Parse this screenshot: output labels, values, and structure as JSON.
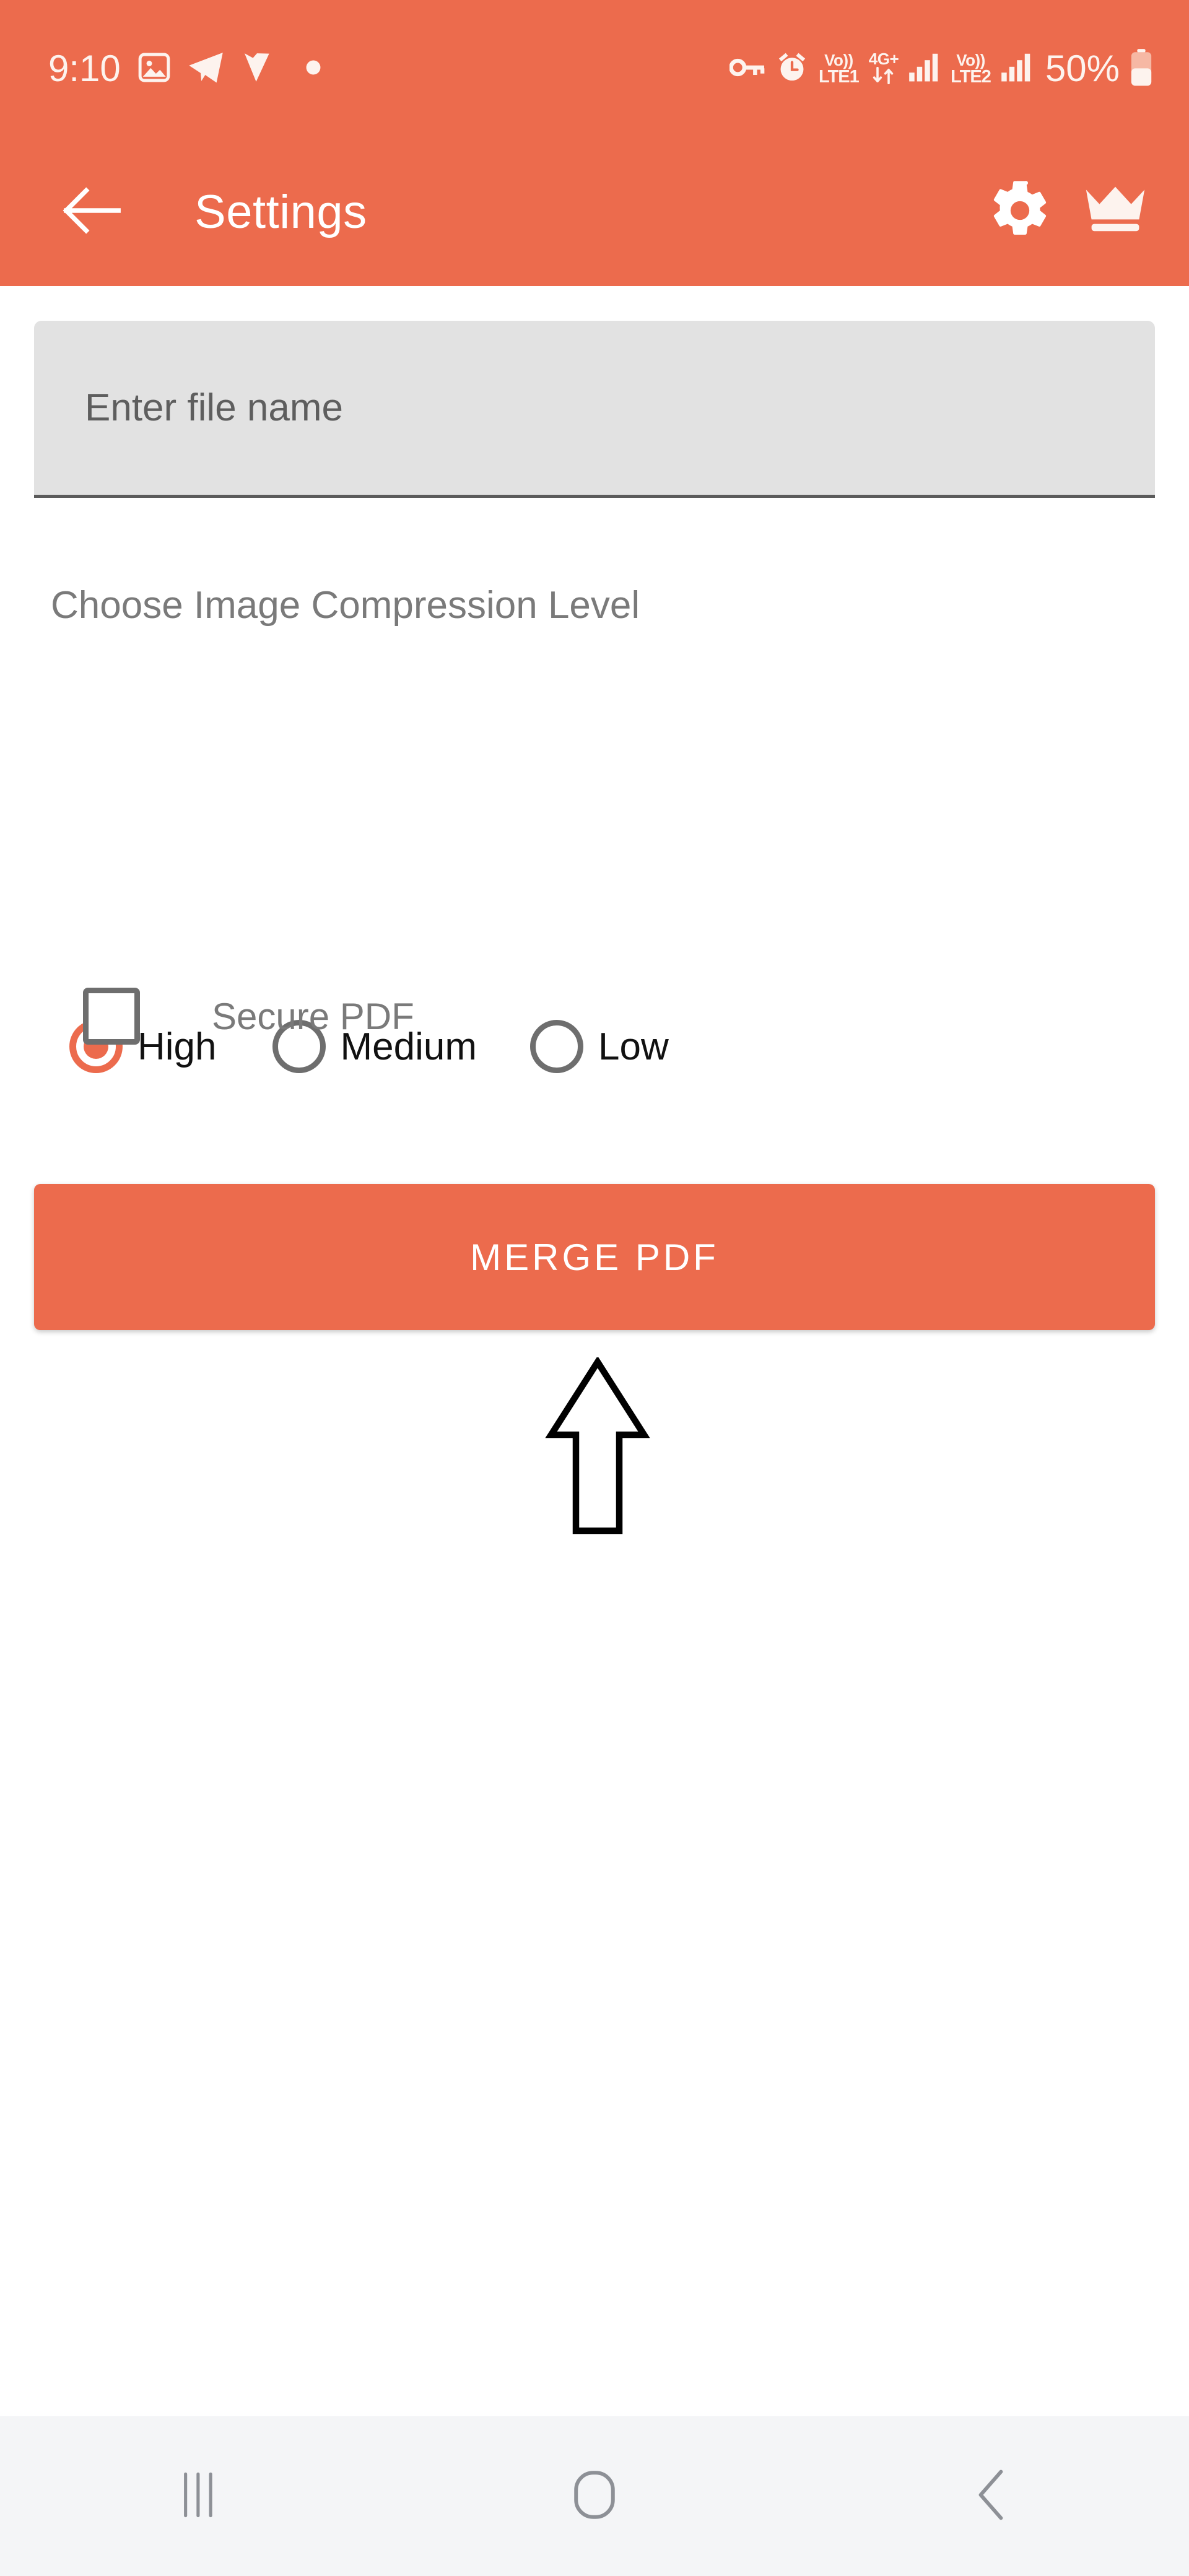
{
  "theme": {
    "accent": "#EC6B4D",
    "appbar_text": "#FFFFFF",
    "field_bg": "#E2E2E2",
    "label_gray": "#7A7A7A",
    "radio_off": "#6E6E6E",
    "navbar_bg": "#F4F5F7",
    "page_bg": "#FFFFFF"
  },
  "status_bar": {
    "time": "9:10",
    "left_icons": [
      "image-icon",
      "telegram-icon",
      "v-app-icon",
      "notification-dot-icon"
    ],
    "right_icons": [
      "key-icon",
      "alarm-clock-icon",
      "volte1-icon",
      "4g-plus-data-icon",
      "signal-bars-1-icon",
      "volte2-icon",
      "signal-bars-2-icon",
      "battery-icon"
    ],
    "volte1_top": "Vo))",
    "volte1_bottom": "LTE1",
    "volte2_top": "Vo))",
    "volte2_bottom": "LTE2",
    "network_type": "4G+",
    "battery_percent": "50%"
  },
  "app_bar": {
    "back_icon": "arrow-left-icon",
    "title": "Settings",
    "actions": [
      {
        "icon": "gear-icon",
        "name": "settings-action"
      },
      {
        "icon": "crown-icon",
        "name": "premium-action"
      }
    ]
  },
  "form": {
    "filename": {
      "placeholder": "Enter file name",
      "value": ""
    },
    "compression": {
      "label": "Choose Image Compression Level",
      "selected": "High",
      "options": [
        {
          "label": "High",
          "selected": true
        },
        {
          "label": "Medium",
          "selected": false
        },
        {
          "label": "Low",
          "selected": false
        }
      ]
    },
    "secure_pdf": {
      "label": "Secure PDF",
      "checked": false
    },
    "submit_label": "MERGE PDF"
  },
  "annotation": {
    "arrow_icon": "arrow-up-outline-annotation",
    "points_to": "MERGE PDF"
  },
  "nav_bar": {
    "buttons": [
      {
        "icon": "recents-icon",
        "name": "nav-recents"
      },
      {
        "icon": "home-icon",
        "name": "nav-home"
      },
      {
        "icon": "back-chevron-icon",
        "name": "nav-back"
      }
    ]
  }
}
